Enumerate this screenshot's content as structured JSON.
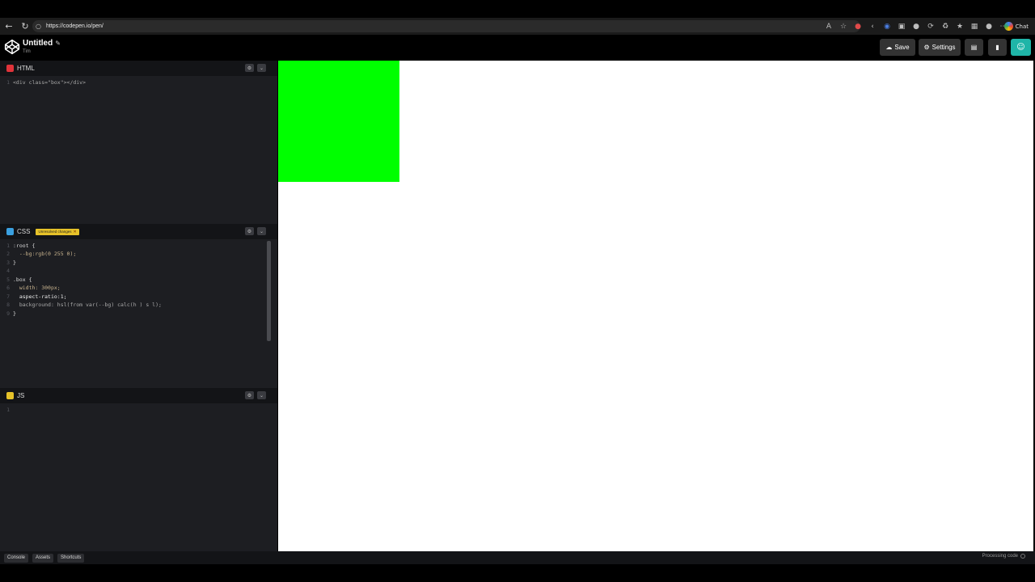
{
  "browser": {
    "url": "https://codepen.io/pen/",
    "chat_label": "Chat"
  },
  "header": {
    "title": "Untitled",
    "user": "Tim",
    "save_label": "Save",
    "settings_label": "Settings"
  },
  "panes": {
    "html": {
      "title": "HTML",
      "badge_color": "#e0333a",
      "lines": [
        {
          "n": "1",
          "text": "<div class=\"box\"></div>"
        }
      ]
    },
    "css": {
      "title": "CSS",
      "badge_color": "#3aa0e0",
      "warning": "Unresolved changes",
      "lines": [
        {
          "n": "1",
          "text": ":root {"
        },
        {
          "n": "2",
          "text": "  --bg:rgb(0 255 0);"
        },
        {
          "n": "3",
          "text": "}"
        },
        {
          "n": "4",
          "text": ""
        },
        {
          "n": "5",
          "text": ".box {"
        },
        {
          "n": "6",
          "text": "  width: 300px;"
        },
        {
          "n": "7",
          "text": "  aspect-ratio:1;"
        },
        {
          "n": "8",
          "text": "  background: hsl(from var(--bg) calc(h ) s l);"
        },
        {
          "n": "9",
          "text": "}"
        }
      ]
    },
    "js": {
      "title": "JS",
      "badge_color": "#e6c229",
      "lines": [
        {
          "n": "1",
          "text": ""
        }
      ]
    }
  },
  "preview": {
    "box_color": "#00ff00"
  },
  "footer": {
    "console": "Console",
    "assets": "Assets",
    "shortcuts": "Shortcuts",
    "status": "Processing code"
  }
}
